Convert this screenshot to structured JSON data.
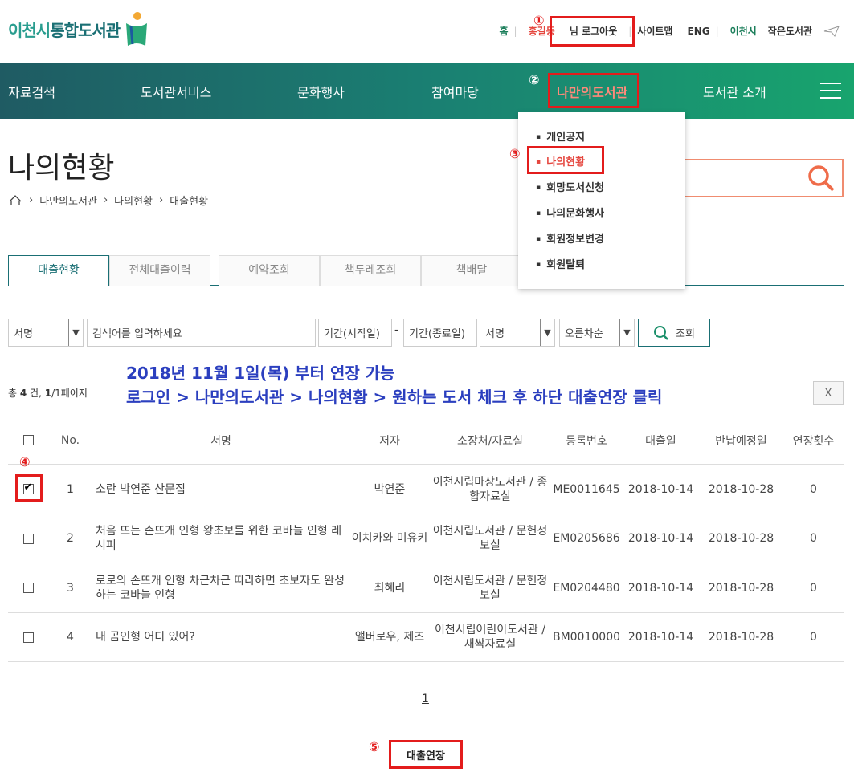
{
  "logo": {
    "part1": "이천시",
    "part2": "통합도서관"
  },
  "topmenu": {
    "home": "홈",
    "username": "홍길동",
    "logout": "님 로그아웃",
    "sitemap": "사이트맵",
    "eng": "ENG",
    "small_lib_a": "이천시",
    "small_lib_b": "작은도서관"
  },
  "annotations": {
    "n1": "①",
    "n2": "②",
    "n3": "③",
    "n4": "④",
    "n5": "⑤"
  },
  "nav": {
    "items": [
      "자료검색",
      "도서관서비스",
      "문화행사",
      "참여마당",
      "나만의도서관",
      "도서관 소개"
    ]
  },
  "dropdown": {
    "items": [
      "개인공지",
      "나의현황",
      "희망도서신청",
      "나의문화행사",
      "회원정보변경",
      "회원탈퇴"
    ]
  },
  "page": {
    "title": "나의현황",
    "breadcrumb": [
      "나만의도서관",
      "나의현황",
      "대출현황"
    ]
  },
  "tabs": [
    "대출현황",
    "전체대출이력",
    "예약조회",
    "책두레조회",
    "책배달"
  ],
  "filter": {
    "field_select": "서명",
    "keyword_placeholder": "검색어를 입력하세요",
    "start_date": "기간(시작일)",
    "dash": "-",
    "end_date": "기간(종료일)",
    "sort_field": "서명",
    "sort_order": "오름차순",
    "search_label": "조회"
  },
  "notice": {
    "line1": "2018년 11월 1일(목) 부터 연장 가능",
    "line2": "로그인 > 나만의도서관 > 나의현황 > 원하는 도서 체크 후 하단 대출연장 클릭"
  },
  "summary": {
    "prefix": "총 ",
    "count": "4",
    "mid": " 건, ",
    "page": "1",
    "suffix": "/1페이지"
  },
  "excel_icon": "X",
  "table": {
    "headers": [
      "No.",
      "서명",
      "저자",
      "소장처/자료실",
      "등록번호",
      "대출일",
      "반납예정일",
      "연장횟수"
    ],
    "rows": [
      {
        "checked": true,
        "no": "1",
        "title": "소란 박연준 산문집",
        "author": "박연준",
        "location": "이천시립마장도서관 / 종합자료실",
        "reg": "ME0011645",
        "loan": "2018-10-14",
        "due": "2018-10-28",
        "ext": "0"
      },
      {
        "checked": false,
        "no": "2",
        "title": "처음 뜨는 손뜨개 인형 왕초보를 위한 코바늘 인형 레시피",
        "author": "이치카와 미유키",
        "location": "이천시립도서관 / 문헌정보실",
        "reg": "EM0205686",
        "loan": "2018-10-14",
        "due": "2018-10-28",
        "ext": "0"
      },
      {
        "checked": false,
        "no": "3",
        "title": "로로의 손뜨개 인형 차근차근 따라하면 초보자도 완성하는 코바늘 인형",
        "author": "최혜리",
        "location": "이천시립도서관 / 문헌정보실",
        "reg": "EM0204480",
        "loan": "2018-10-14",
        "due": "2018-10-28",
        "ext": "0"
      },
      {
        "checked": false,
        "no": "4",
        "title": "내 곰인형 어디 있어?",
        "author": "앨버로우, 제즈",
        "location": "이천시립어린이도서관 / 새싹자료실",
        "reg": "BM0010000",
        "loan": "2018-10-14",
        "due": "2018-10-28",
        "ext": "0"
      }
    ]
  },
  "pagination": {
    "current": "1"
  },
  "loan_extend_label": "대출연장",
  "colors": {
    "accent": "#1a6f74",
    "highlight": "#e31c1c",
    "notice": "#2b3fbf"
  }
}
